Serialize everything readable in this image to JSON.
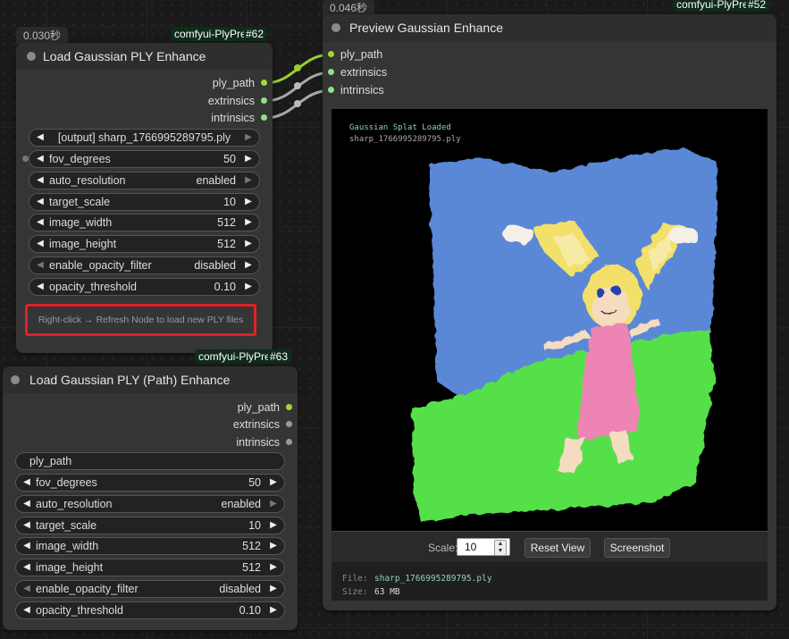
{
  "colors": {
    "canvas_bg": "#1a1a1a",
    "node_bg": "#353535",
    "badge_bg": "#0f2b1a",
    "slot_green": "#a6d63d",
    "slot_gray": "#bbbbbb",
    "slot_light_green": "#8fe08a",
    "highlight_red": "#e0202a",
    "sky_blue": "#5a88d6",
    "grass_green": "#54e04a"
  },
  "node62": {
    "timing": "0.030秒",
    "badge_name": "comfyui-PlyPre",
    "badge_id": "#62",
    "title": "Load Gaussian PLY Enhance",
    "outputs": [
      "ply_path",
      "extrinsics",
      "intrinsics"
    ],
    "file_select": "[output] sharp_1766995289795.ply",
    "widgets": [
      {
        "label": "fov_degrees",
        "value": "50"
      },
      {
        "label": "auto_resolution",
        "value": "enabled"
      },
      {
        "label": "target_scale",
        "value": "10"
      },
      {
        "label": "image_width",
        "value": "512"
      },
      {
        "label": "image_height",
        "value": "512"
      },
      {
        "label": "enable_opacity_filter",
        "value": "disabled"
      },
      {
        "label": "opacity_threshold",
        "value": "0.10"
      }
    ],
    "hint": "Right-click → Refresh Node to load new PLY files"
  },
  "node63": {
    "badge_name": "comfyui-PlyPre",
    "badge_id": "#63",
    "title": "Load Gaussian PLY (Path) Enhance",
    "outputs": [
      "ply_path",
      "extrinsics",
      "intrinsics"
    ],
    "path_input": "ply_path",
    "widgets": [
      {
        "label": "fov_degrees",
        "value": "50"
      },
      {
        "label": "auto_resolution",
        "value": "enabled"
      },
      {
        "label": "target_scale",
        "value": "10"
      },
      {
        "label": "image_width",
        "value": "512"
      },
      {
        "label": "image_height",
        "value": "512"
      },
      {
        "label": "enable_opacity_filter",
        "value": "disabled"
      },
      {
        "label": "opacity_threshold",
        "value": "0.10"
      }
    ]
  },
  "node52": {
    "timing": "0.046秒",
    "badge_name": "comfyui-PlyPre",
    "badge_id": "#52",
    "title": "Preview Gaussian Enhance",
    "inputs": [
      "ply_path",
      "extrinsics",
      "intrinsics"
    ],
    "overlay_line1": "Gaussian Splat Loaded",
    "overlay_line2": "sharp_1766995289795.ply",
    "scale_label": "Scale:",
    "scale_value": "10",
    "reset_label": "Reset View",
    "screenshot_label": "Screenshot",
    "file_label": "File:",
    "file_value": "sharp_1766995289795.ply",
    "size_label": "Size:",
    "size_value": "63 MB"
  }
}
